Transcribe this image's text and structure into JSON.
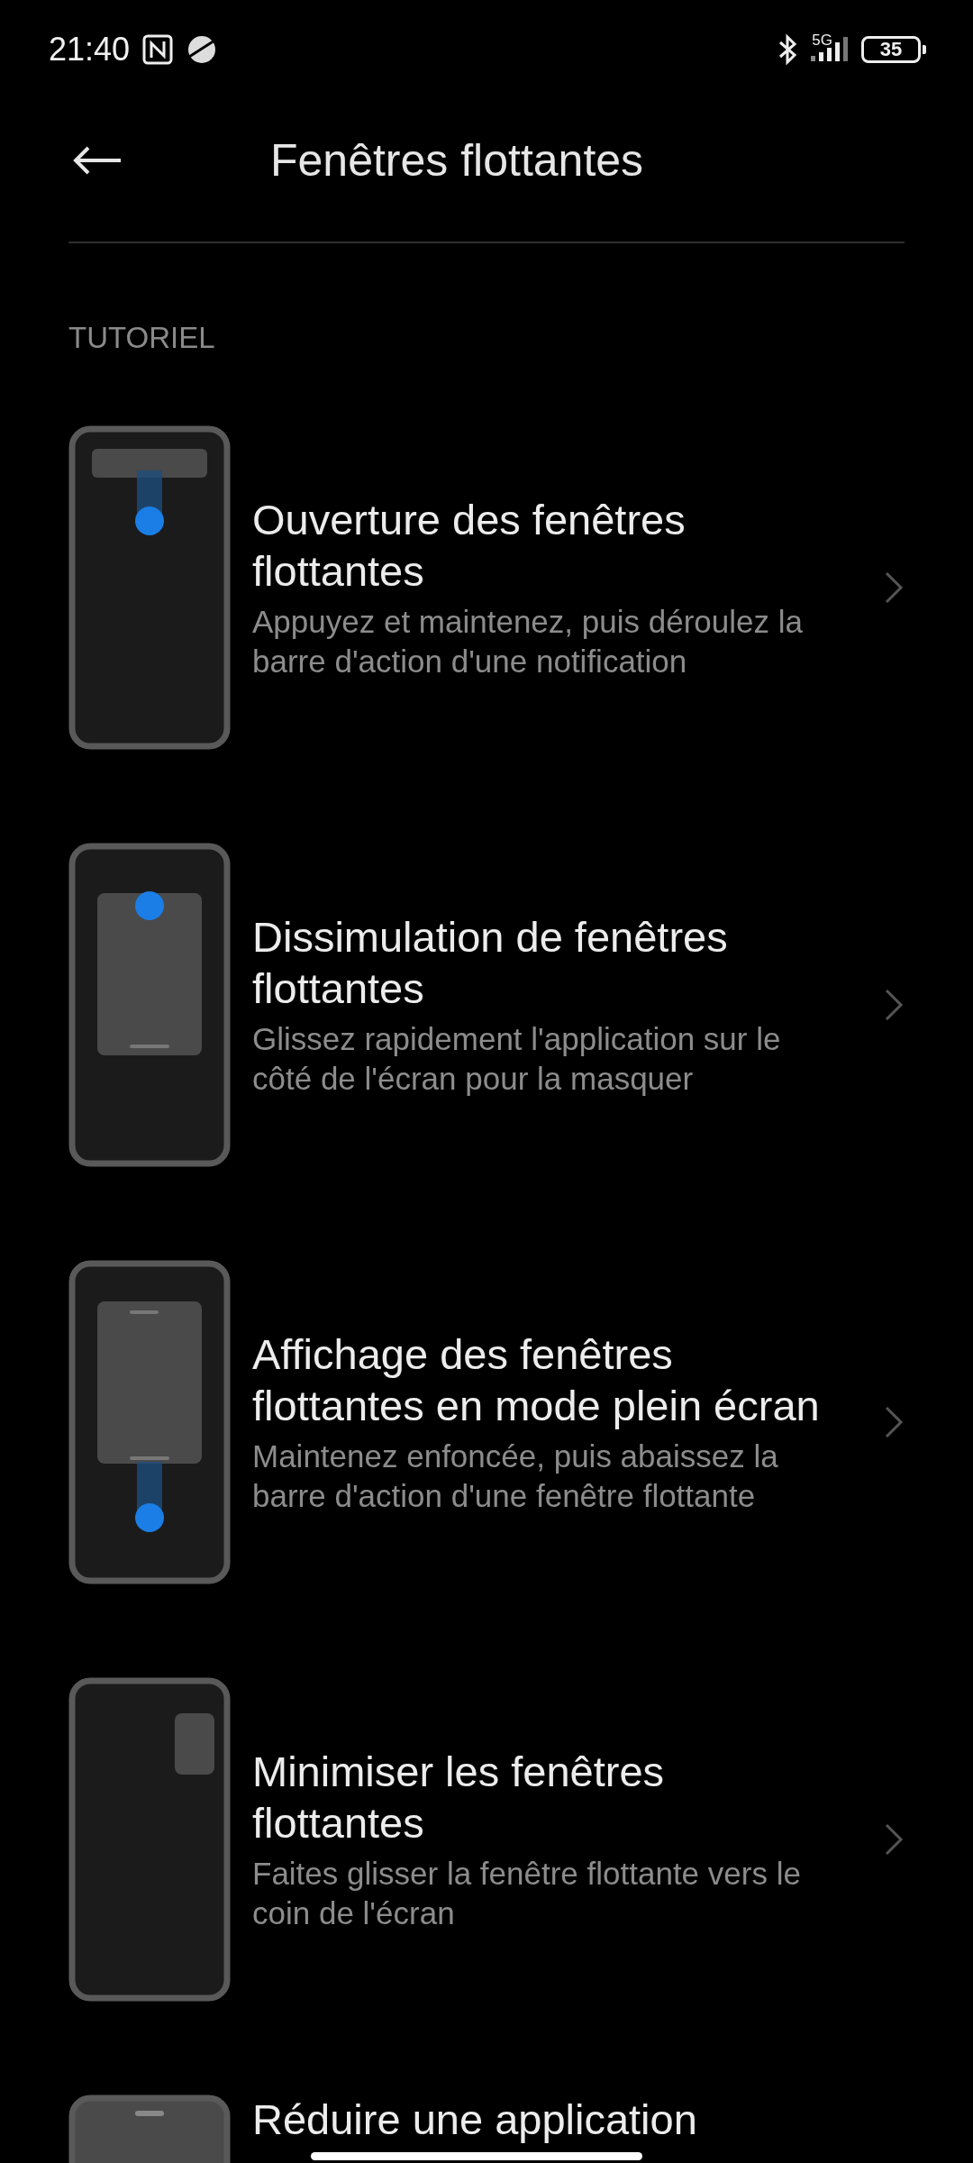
{
  "status_bar": {
    "time": "21:40",
    "network": "5G",
    "battery": "35"
  },
  "header": {
    "title": "Fenêtres flottantes"
  },
  "section": {
    "label": "TUTORIEL"
  },
  "items": [
    {
      "kind": "open",
      "title": "Ouverture des fenêtres flottantes",
      "subtitle": "Appuyez et maintenez, puis déroulez la barre d'action d'une notification"
    },
    {
      "kind": "hide",
      "title": "Dissimulation de fenêtres flottantes",
      "subtitle": "Glissez rapidement l'application sur le côté de l'écran pour la masquer"
    },
    {
      "kind": "fullscreen",
      "title": "Affichage des fenêtres flottantes en mode plein écran",
      "subtitle": "Maintenez enfoncée, puis abaissez la barre d'action d'une fenêtre flottante"
    },
    {
      "kind": "minimize",
      "title": "Minimiser les fenêtres flottantes",
      "subtitle": "Faites glisser la fenêtre flottante vers le coin de l'écran"
    },
    {
      "kind": "reduce",
      "title": "Réduire une application"
    }
  ]
}
